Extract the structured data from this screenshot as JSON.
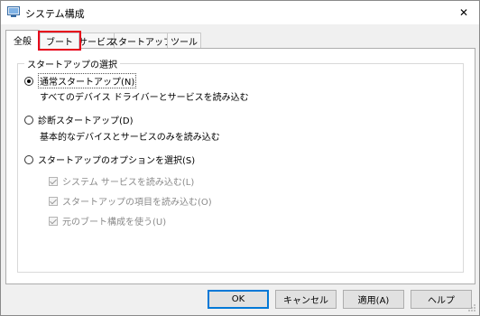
{
  "window": {
    "title": "システム構成",
    "icon": "msconfig-icon",
    "close_glyph": "✕"
  },
  "tabs": [
    {
      "label": "全般",
      "active": true
    },
    {
      "label": "ブート",
      "active": false,
      "highlighted": true
    },
    {
      "label": "サービス",
      "active": false
    },
    {
      "label": "スタートアップ",
      "active": false
    },
    {
      "label": "ツール",
      "active": false
    }
  ],
  "startup_group": {
    "title": "スタートアップの選択",
    "normal": {
      "label": "通常スタートアップ(N)",
      "desc": "すべてのデバイス ドライバーとサービスを読み込む",
      "checked": true
    },
    "diagnostic": {
      "label": "診断スタートアップ(D)",
      "desc": "基本的なデバイスとサービスのみを読み込む",
      "checked": false
    },
    "selective": {
      "label": "スタートアップのオプションを選択(S)",
      "checked": false
    },
    "options": [
      {
        "label": "システム サービスを読み込む(L)",
        "checked": true,
        "enabled": false
      },
      {
        "label": "スタートアップの項目を読み込む(O)",
        "checked": true,
        "enabled": false
      },
      {
        "label": "元のブート構成を使う(U)",
        "checked": true,
        "enabled": false
      }
    ]
  },
  "buttons": {
    "ok": "OK",
    "cancel": "キャンセル",
    "apply": "適用(A)",
    "help": "ヘルプ"
  },
  "colors": {
    "highlight": "#e6001a",
    "default_button_border": "#0078d7"
  }
}
